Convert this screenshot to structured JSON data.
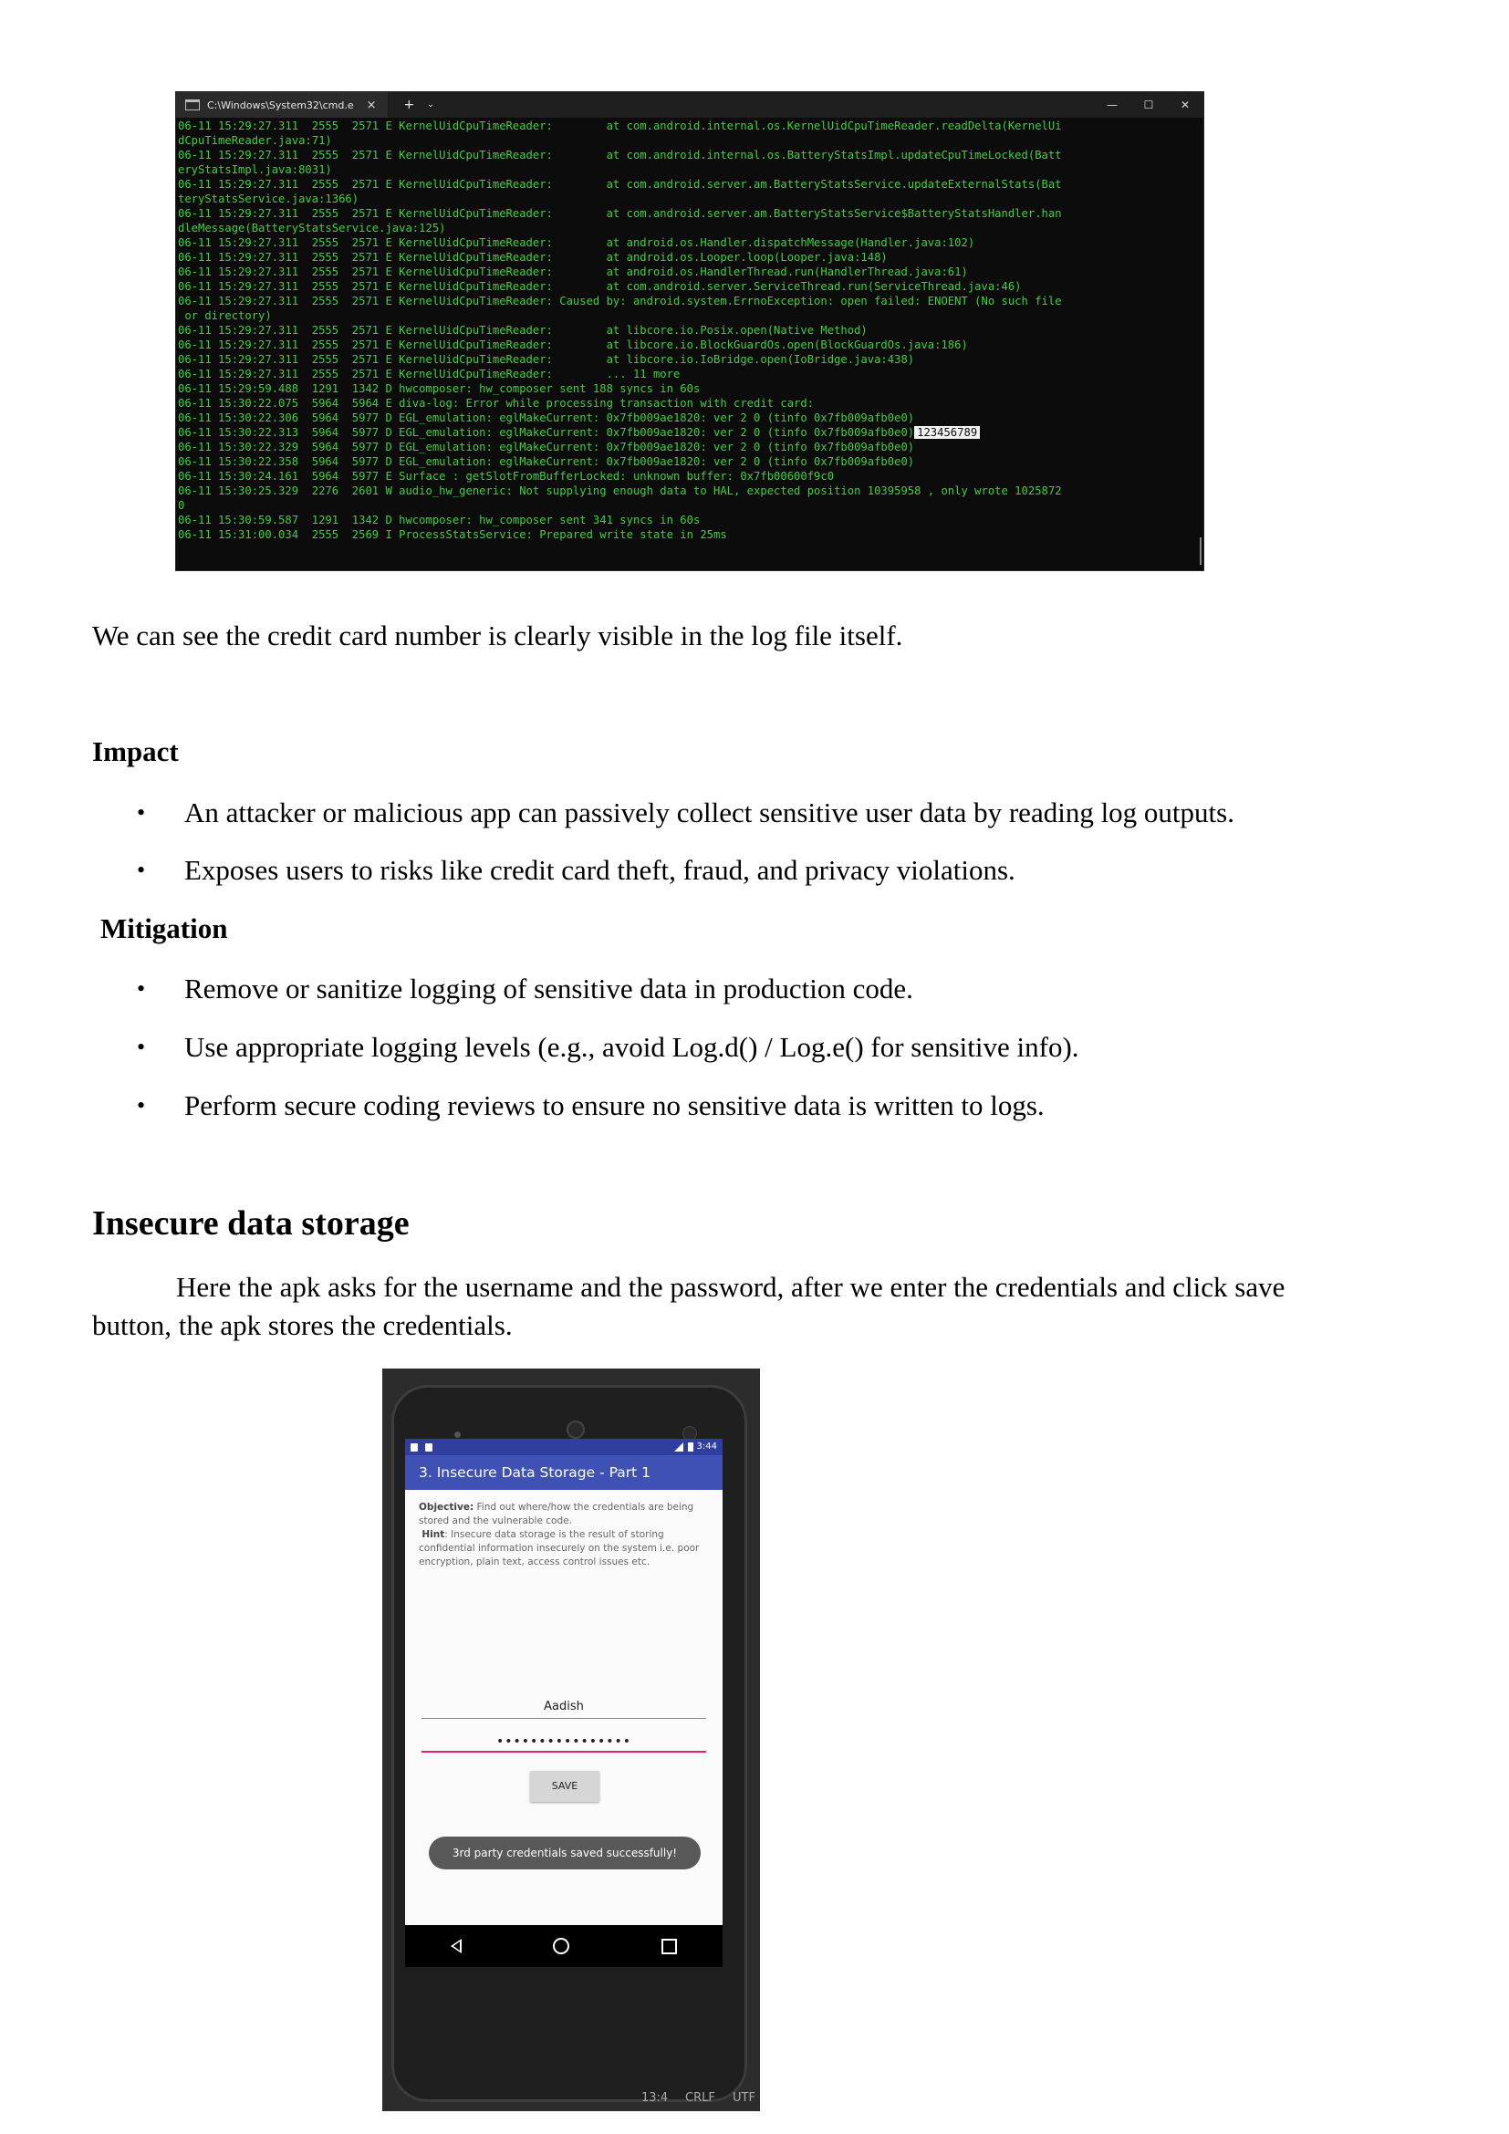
{
  "terminal": {
    "tab_title": "C:\\Windows\\System32\\cmd.e",
    "tab_close": "×",
    "new_tab": "+",
    "dropdown": "⌄",
    "minimize": "—",
    "maximize": "☐",
    "close": "✕",
    "lines": [
      "06-11 15:29:27.311  2555  2571 E KernelUidCpuTimeReader:        at com.android.internal.os.KernelUidCpuTimeReader.readDelta(KernelUi",
      "dCpuTimeReader.java:71)",
      "06-11 15:29:27.311  2555  2571 E KernelUidCpuTimeReader:        at com.android.internal.os.BatteryStatsImpl.updateCpuTimeLocked(Batt",
      "eryStatsImpl.java:8031)",
      "06-11 15:29:27.311  2555  2571 E KernelUidCpuTimeReader:        at com.android.server.am.BatteryStatsService.updateExternalStats(Bat",
      "teryStatsService.java:1366)",
      "06-11 15:29:27.311  2555  2571 E KernelUidCpuTimeReader:        at com.android.server.am.BatteryStatsService$BatteryStatsHandler.han",
      "dleMessage(BatteryStatsService.java:125)",
      "06-11 15:29:27.311  2555  2571 E KernelUidCpuTimeReader:        at android.os.Handler.dispatchMessage(Handler.java:102)",
      "06-11 15:29:27.311  2555  2571 E KernelUidCpuTimeReader:        at android.os.Looper.loop(Looper.java:148)",
      "06-11 15:29:27.311  2555  2571 E KernelUidCpuTimeReader:        at android.os.HandlerThread.run(HandlerThread.java:61)",
      "06-11 15:29:27.311  2555  2571 E KernelUidCpuTimeReader:        at com.android.server.ServiceThread.run(ServiceThread.java:46)",
      "06-11 15:29:27.311  2555  2571 E KernelUidCpuTimeReader: Caused by: android.system.ErrnoException: open failed: ENOENT (No such file",
      " or directory)",
      "06-11 15:29:27.311  2555  2571 E KernelUidCpuTimeReader:        at libcore.io.Posix.open(Native Method)",
      "06-11 15:29:27.311  2555  2571 E KernelUidCpuTimeReader:        at libcore.io.BlockGuardOs.open(BlockGuardOs.java:186)",
      "06-11 15:29:27.311  2555  2571 E KernelUidCpuTimeReader:        at libcore.io.IoBridge.open(IoBridge.java:438)",
      "06-11 15:29:27.311  2555  2571 E KernelUidCpuTimeReader:        ... 11 more",
      "06-11 15:29:59.488  1291  1342 D hwcomposer: hw_composer sent 188 syncs in 60s",
      "06-11 15:30:22.075  5964  5964 E diva-log: Error while processing transaction with credit card: ",
      "06-11 15:30:22.306  5964  5977 D EGL_emulation: eglMakeCurrent: 0x7fb009ae1820: ver 2 0 (tinfo 0x7fb009afb0e0)",
      "06-11 15:30:22.313  5964  5977 D EGL_emulation: eglMakeCurrent: 0x7fb009ae1820: ver 2 0 (tinfo 0x7fb009afb0e0)",
      "06-11 15:30:22.329  5964  5977 D EGL_emulation: eglMakeCurrent: 0x7fb009ae1820: ver 2 0 (tinfo 0x7fb009afb0e0)",
      "06-11 15:30:22.358  5964  5977 D EGL_emulation: eglMakeCurrent: 0x7fb009ae1820: ver 2 0 (tinfo 0x7fb009afb0e0)",
      "06-11 15:30:24.161  5964  5977 E Surface : getSlotFromBufferLocked: unknown buffer: 0x7fb00600f9c0",
      "06-11 15:30:25.329  2276  2601 W audio_hw_generic: Not supplying enough data to HAL, expected position 10395958 , only wrote 1025872",
      "0",
      "06-11 15:30:59.587  1291  1342 D hwcomposer: hw_composer sent 341 syncs in 60s",
      "06-11 15:31:00.034  2555  2569 I ProcessStatsService: Prepared write state in 25ms"
    ],
    "highlight": "123456789"
  },
  "doc": {
    "intro": "We can see the credit card number is clearly visible in the log file itself.",
    "impact_heading": "Impact",
    "impact_items": [
      "An attacker or malicious app can passively collect sensitive user data by reading log outputs.",
      "Exposes users to risks like credit card theft, fraud, and privacy violations."
    ],
    "mitigation_heading": "Mitigation",
    "mitigation_items": [
      "Remove or sanitize logging of sensitive data in production code.",
      "Use appropriate logging levels (e.g., avoid Log.d() / Log.e() for sensitive info).",
      "Perform secure coding reviews to ensure no sensitive data is written to logs."
    ],
    "bullet": "•",
    "section_title": "Insecure data storage",
    "section_para_1": "Here the apk asks for the username and the password, after we enter the credentials and click save",
    "section_para_2": "button, the apk stores the credentials."
  },
  "phone": {
    "time": "3:44",
    "app_title": "3. Insecure Data Storage - Part 1",
    "objective_label": "Objective:",
    "objective_text": " Find out where/how the credentials are being stored and the vulnerable code.",
    "hint_label": "Hint",
    "hint_text": ": Insecure data storage is the result of storing confidential information insecurely on the system i.e. poor encryption, plain text, access control issues etc.",
    "username": "Aadish",
    "password": "••••••••••••••••",
    "save": "SAVE",
    "toast": "3rd party credentials saved successfully!",
    "ide_position": "13:4",
    "ide_eol": "CRLF",
    "ide_enc": "UTF"
  }
}
